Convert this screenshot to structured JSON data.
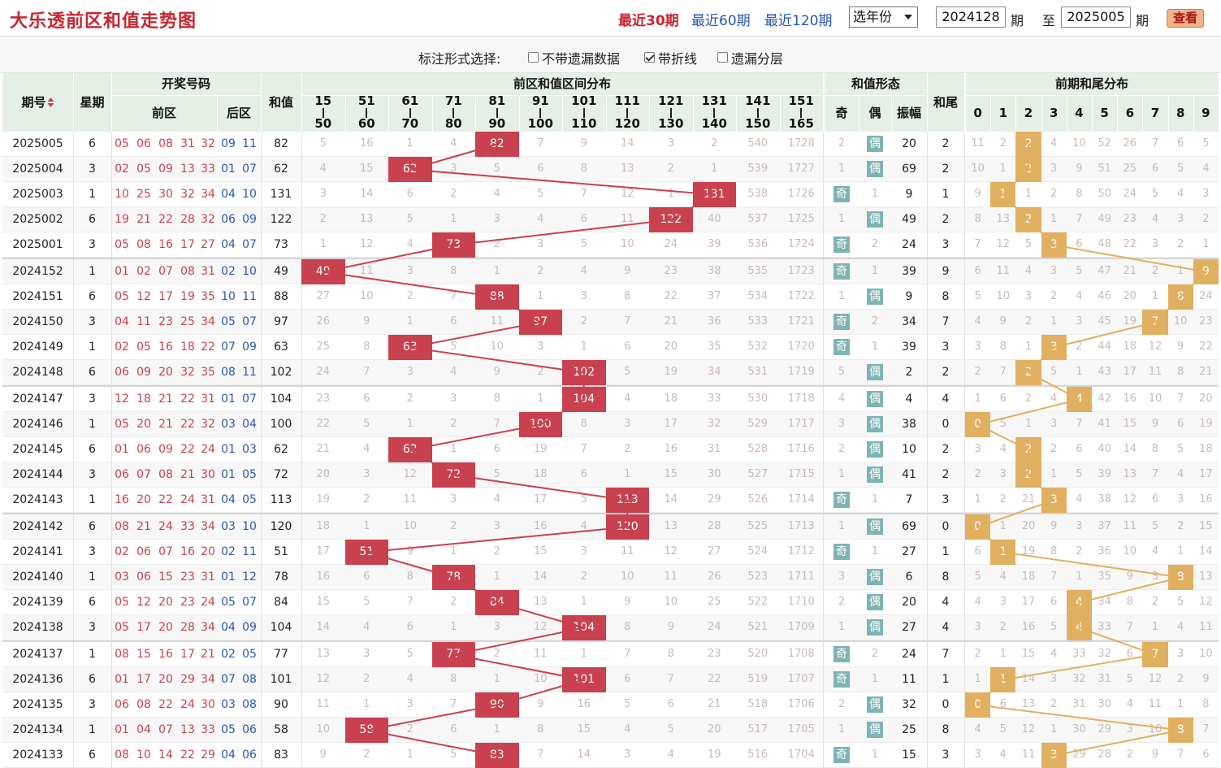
{
  "header": {
    "title": "大乐透前区和值走势图",
    "period_links": [
      "最近30期",
      "最近60期",
      "最近120期"
    ],
    "year_select": "选年份",
    "from_issue": "2024128",
    "to_issue": "2025005",
    "issue_unit": "期",
    "to_label": "至",
    "query_button": "查看"
  },
  "options": {
    "label": "标注形式选择:",
    "items": [
      {
        "label": "不带遗漏数据",
        "checked": false
      },
      {
        "label": "带折线",
        "checked": true
      },
      {
        "label": "遗漏分层",
        "checked": false
      }
    ]
  },
  "table_headers": {
    "issue": "期号",
    "weekday": "星期",
    "draw": "开奖号码",
    "front": "前区",
    "back": "后区",
    "sum": "和值",
    "distribution": "前区和值区间分布",
    "ranges": [
      [
        "15",
        "50"
      ],
      [
        "51",
        "60"
      ],
      [
        "61",
        "70"
      ],
      [
        "71",
        "80"
      ],
      [
        "81",
        "90"
      ],
      [
        "91",
        "100"
      ],
      [
        "101",
        "110"
      ],
      [
        "111",
        "120"
      ],
      [
        "121",
        "130"
      ],
      [
        "131",
        "140"
      ],
      [
        "141",
        "150"
      ],
      [
        "151",
        "165"
      ]
    ],
    "form": "和值形态",
    "odd": "奇",
    "even": "偶",
    "amp": "振幅",
    "tail": "和尾",
    "tail_dist": "前期和尾分布",
    "digits": [
      "0",
      "1",
      "2",
      "3",
      "4",
      "5",
      "6",
      "7",
      "8",
      "9"
    ]
  },
  "colors": {
    "red_ball": "#c9404f",
    "blue_ball": "#2a56b8",
    "hit": "#c9404f",
    "tail_hit": "#e0b060",
    "odd_even_box": "#7fb3b3"
  },
  "rows": [
    {
      "issue": "2025005",
      "wk": "6",
      "front": [
        "05",
        "06",
        "08",
        "31",
        "32"
      ],
      "back": [
        "09",
        "11"
      ],
      "sum": "82",
      "dist": [
        "5",
        "16",
        "1",
        "4",
        "82",
        "7",
        "9",
        "14",
        "3",
        "2",
        "540",
        "1728"
      ],
      "hit": 4,
      "oe": [
        "2",
        "偶"
      ],
      "oeHit": 1,
      "amp": "20",
      "tail": "2",
      "td": [
        "11",
        "2",
        "2",
        "4",
        "10",
        "52",
        "26",
        "7",
        "6",
        "5"
      ],
      "tHit": 2
    },
    {
      "issue": "2025004",
      "wk": "3",
      "front": [
        "02",
        "05",
        "09",
        "13",
        "33"
      ],
      "back": [
        "01",
        "07"
      ],
      "sum": "62",
      "dist": [
        "4",
        "15",
        "62",
        "3",
        "5",
        "6",
        "8",
        "13",
        "2",
        "1",
        "539",
        "1727"
      ],
      "hit": 2,
      "oe": [
        "1",
        "偶"
      ],
      "oeHit": 1,
      "amp": "69",
      "tail": "2",
      "td": [
        "10",
        "1",
        "2",
        "3",
        "9",
        "51",
        "25",
        "6",
        "5",
        "4"
      ],
      "tHit": 2
    },
    {
      "issue": "2025003",
      "wk": "1",
      "front": [
        "10",
        "25",
        "30",
        "32",
        "34"
      ],
      "back": [
        "04",
        "10"
      ],
      "sum": "131",
      "dist": [
        "3",
        "14",
        "6",
        "2",
        "4",
        "5",
        "7",
        "12",
        "1",
        "131",
        "538",
        "1726"
      ],
      "hit": 9,
      "oe": [
        "奇",
        "1"
      ],
      "oeHit": 0,
      "amp": "9",
      "tail": "1",
      "td": [
        "9",
        "1",
        "1",
        "2",
        "8",
        "50",
        "24",
        "5",
        "4",
        "3"
      ],
      "tHit": 1
    },
    {
      "issue": "2025002",
      "wk": "6",
      "front": [
        "19",
        "21",
        "22",
        "28",
        "32"
      ],
      "back": [
        "06",
        "09"
      ],
      "sum": "122",
      "dist": [
        "2",
        "13",
        "5",
        "1",
        "3",
        "4",
        "6",
        "11",
        "122",
        "40",
        "537",
        "1725"
      ],
      "hit": 8,
      "oe": [
        "1",
        "偶"
      ],
      "oeHit": 1,
      "amp": "49",
      "tail": "2",
      "td": [
        "8",
        "13",
        "2",
        "1",
        "7",
        "49",
        "23",
        "4",
        "3",
        "2"
      ],
      "tHit": 2
    },
    {
      "issue": "2025001",
      "wk": "3",
      "front": [
        "05",
        "08",
        "16",
        "17",
        "27"
      ],
      "back": [
        "04",
        "07"
      ],
      "sum": "73",
      "dist": [
        "1",
        "12",
        "4",
        "73",
        "2",
        "3",
        "5",
        "10",
        "24",
        "39",
        "536",
        "1724"
      ],
      "hit": 3,
      "oe": [
        "奇",
        "2"
      ],
      "oeHit": 0,
      "amp": "24",
      "tail": "3",
      "td": [
        "7",
        "12",
        "5",
        "3",
        "6",
        "48",
        "22",
        "3",
        "2",
        "1"
      ],
      "tHit": 3
    },
    {
      "issue": "2024152",
      "wk": "1",
      "front": [
        "01",
        "02",
        "07",
        "08",
        "31"
      ],
      "back": [
        "02",
        "10"
      ],
      "sum": "49",
      "dist": [
        "49",
        "11",
        "3",
        "8",
        "1",
        "2",
        "4",
        "9",
        "23",
        "38",
        "535",
        "1723"
      ],
      "hit": 0,
      "oe": [
        "奇",
        "1"
      ],
      "oeHit": 0,
      "amp": "39",
      "tail": "9",
      "td": [
        "6",
        "11",
        "4",
        "3",
        "5",
        "47",
        "21",
        "2",
        "1",
        "9"
      ],
      "tHit": 9
    },
    {
      "issue": "2024151",
      "wk": "6",
      "front": [
        "05",
        "12",
        "17",
        "19",
        "35"
      ],
      "back": [
        "10",
        "11"
      ],
      "sum": "88",
      "dist": [
        "27",
        "10",
        "2",
        "7",
        "88",
        "1",
        "3",
        "8",
        "22",
        "37",
        "534",
        "1722"
      ],
      "hit": 4,
      "oe": [
        "1",
        "偶"
      ],
      "oeHit": 1,
      "amp": "9",
      "tail": "8",
      "td": [
        "5",
        "10",
        "3",
        "2",
        "4",
        "46",
        "20",
        "1",
        "8",
        "24"
      ],
      "tHit": 8
    },
    {
      "issue": "2024150",
      "wk": "3",
      "front": [
        "04",
        "11",
        "23",
        "25",
        "34"
      ],
      "back": [
        "05",
        "07"
      ],
      "sum": "97",
      "dist": [
        "26",
        "9",
        "1",
        "6",
        "11",
        "97",
        "2",
        "7",
        "21",
        "36",
        "533",
        "1721"
      ],
      "hit": 5,
      "oe": [
        "奇",
        "2"
      ],
      "oeHit": 0,
      "amp": "34",
      "tail": "7",
      "td": [
        "4",
        "9",
        "2",
        "1",
        "3",
        "45",
        "19",
        "7",
        "10",
        "23"
      ],
      "tHit": 7
    },
    {
      "issue": "2024149",
      "wk": "1",
      "front": [
        "02",
        "05",
        "16",
        "18",
        "22"
      ],
      "back": [
        "07",
        "09"
      ],
      "sum": "63",
      "dist": [
        "25",
        "8",
        "63",
        "5",
        "10",
        "3",
        "1",
        "6",
        "20",
        "35",
        "532",
        "1720"
      ],
      "hit": 2,
      "oe": [
        "奇",
        "1"
      ],
      "oeHit": 0,
      "amp": "39",
      "tail": "3",
      "td": [
        "3",
        "8",
        "1",
        "3",
        "2",
        "44",
        "18",
        "12",
        "9",
        "22"
      ],
      "tHit": 3
    },
    {
      "issue": "2024148",
      "wk": "6",
      "front": [
        "06",
        "09",
        "20",
        "32",
        "35"
      ],
      "back": [
        "08",
        "11"
      ],
      "sum": "102",
      "dist": [
        "24",
        "7",
        "3",
        "4",
        "9",
        "2",
        "102",
        "5",
        "19",
        "34",
        "531",
        "1719"
      ],
      "hit": 6,
      "oe": [
        "5",
        "偶"
      ],
      "oeHit": 1,
      "amp": "2",
      "tail": "2",
      "td": [
        "2",
        "7",
        "2",
        "5",
        "1",
        "43",
        "17",
        "11",
        "8",
        "21"
      ],
      "tHit": 2
    },
    {
      "issue": "2024147",
      "wk": "3",
      "front": [
        "12",
        "18",
        "21",
        "22",
        "31"
      ],
      "back": [
        "01",
        "07"
      ],
      "sum": "104",
      "dist": [
        "23",
        "6",
        "2",
        "3",
        "8",
        "1",
        "104",
        "4",
        "18",
        "33",
        "530",
        "1718"
      ],
      "hit": 6,
      "oe": [
        "4",
        "偶"
      ],
      "oeHit": 1,
      "amp": "4",
      "tail": "4",
      "td": [
        "1",
        "6",
        "2",
        "4",
        "4",
        "42",
        "16",
        "10",
        "7",
        "20"
      ],
      "tHit": 4
    },
    {
      "issue": "2024146",
      "wk": "1",
      "front": [
        "05",
        "20",
        "21",
        "22",
        "32"
      ],
      "back": [
        "03",
        "04"
      ],
      "sum": "100",
      "dist": [
        "22",
        "5",
        "1",
        "2",
        "7",
        "100",
        "8",
        "3",
        "17",
        "32",
        "529",
        "1717"
      ],
      "hit": 5,
      "oe": [
        "3",
        "偶"
      ],
      "oeHit": 1,
      "amp": "38",
      "tail": "0",
      "td": [
        "0",
        "5",
        "1",
        "3",
        "7",
        "41",
        "15",
        "9",
        "6",
        "19"
      ],
      "tHit": 0
    },
    {
      "issue": "2024145",
      "wk": "6",
      "front": [
        "01",
        "06",
        "09",
        "22",
        "24"
      ],
      "back": [
        "01",
        "03"
      ],
      "sum": "62",
      "dist": [
        "21",
        "4",
        "62",
        "1",
        "6",
        "19",
        "7",
        "2",
        "16",
        "31",
        "528",
        "1716"
      ],
      "hit": 2,
      "oe": [
        "2",
        "偶"
      ],
      "oeHit": 1,
      "amp": "10",
      "tail": "2",
      "td": [
        "3",
        "4",
        "2",
        "2",
        "6",
        "40",
        "14",
        "8",
        "5",
        "18"
      ],
      "tHit": 2
    },
    {
      "issue": "2024144",
      "wk": "3",
      "front": [
        "06",
        "07",
        "08",
        "21",
        "30"
      ],
      "back": [
        "01",
        "05"
      ],
      "sum": "72",
      "dist": [
        "20",
        "3",
        "12",
        "72",
        "5",
        "18",
        "6",
        "1",
        "15",
        "30",
        "527",
        "1715"
      ],
      "hit": 3,
      "oe": [
        "1",
        "偶"
      ],
      "oeHit": 1,
      "amp": "41",
      "tail": "2",
      "td": [
        "2",
        "3",
        "2",
        "1",
        "5",
        "39",
        "13",
        "7",
        "4",
        "17"
      ],
      "tHit": 2
    },
    {
      "issue": "2024143",
      "wk": "1",
      "front": [
        "16",
        "20",
        "22",
        "24",
        "31"
      ],
      "back": [
        "04",
        "05"
      ],
      "sum": "113",
      "dist": [
        "19",
        "2",
        "11",
        "3",
        "4",
        "17",
        "5",
        "113",
        "14",
        "29",
        "526",
        "1714"
      ],
      "hit": 7,
      "oe": [
        "奇",
        "1"
      ],
      "oeHit": 0,
      "amp": "7",
      "tail": "3",
      "td": [
        "1",
        "2",
        "21",
        "3",
        "4",
        "38",
        "12",
        "6",
        "3",
        "16"
      ],
      "tHit": 3
    },
    {
      "issue": "2024142",
      "wk": "6",
      "front": [
        "08",
        "21",
        "24",
        "33",
        "34"
      ],
      "back": [
        "03",
        "10"
      ],
      "sum": "120",
      "dist": [
        "18",
        "1",
        "10",
        "2",
        "3",
        "16",
        "4",
        "120",
        "13",
        "28",
        "525",
        "1713"
      ],
      "hit": 7,
      "oe": [
        "1",
        "偶"
      ],
      "oeHit": 1,
      "amp": "69",
      "tail": "0",
      "td": [
        "0",
        "1",
        "20",
        "9",
        "3",
        "37",
        "11",
        "5",
        "2",
        "15"
      ],
      "tHit": 0
    },
    {
      "issue": "2024141",
      "wk": "3",
      "front": [
        "02",
        "06",
        "07",
        "16",
        "20"
      ],
      "back": [
        "02",
        "11"
      ],
      "sum": "51",
      "dist": [
        "17",
        "51",
        "9",
        "1",
        "2",
        "15",
        "3",
        "11",
        "12",
        "27",
        "524",
        "1712"
      ],
      "hit": 1,
      "oe": [
        "奇",
        "1"
      ],
      "oeHit": 0,
      "amp": "27",
      "tail": "1",
      "td": [
        "6",
        "1",
        "19",
        "8",
        "2",
        "36",
        "10",
        "4",
        "1",
        "14"
      ],
      "tHit": 1
    },
    {
      "issue": "2024140",
      "wk": "1",
      "front": [
        "03",
        "06",
        "15",
        "23",
        "31"
      ],
      "back": [
        "01",
        "12"
      ],
      "sum": "78",
      "dist": [
        "16",
        "6",
        "8",
        "78",
        "1",
        "14",
        "2",
        "10",
        "11",
        "26",
        "523",
        "1711"
      ],
      "hit": 3,
      "oe": [
        "3",
        "偶"
      ],
      "oeHit": 1,
      "amp": "6",
      "tail": "8",
      "td": [
        "5",
        "4",
        "18",
        "7",
        "1",
        "35",
        "9",
        "3",
        "8",
        "13"
      ],
      "tHit": 8
    },
    {
      "issue": "2024139",
      "wk": "6",
      "front": [
        "05",
        "12",
        "20",
        "23",
        "24"
      ],
      "back": [
        "05",
        "07"
      ],
      "sum": "84",
      "dist": [
        "15",
        "5",
        "7",
        "2",
        "84",
        "13",
        "1",
        "9",
        "10",
        "25",
        "522",
        "1710"
      ],
      "hit": 4,
      "oe": [
        "2",
        "偶"
      ],
      "oeHit": 1,
      "amp": "20",
      "tail": "4",
      "td": [
        "4",
        "3",
        "17",
        "6",
        "4",
        "34",
        "8",
        "2",
        "5",
        "12"
      ],
      "tHit": 4
    },
    {
      "issue": "2024138",
      "wk": "3",
      "front": [
        "05",
        "17",
        "20",
        "28",
        "34"
      ],
      "back": [
        "04",
        "09"
      ],
      "sum": "104",
      "dist": [
        "14",
        "4",
        "6",
        "1",
        "3",
        "12",
        "104",
        "8",
        "9",
        "24",
        "521",
        "1709"
      ],
      "hit": 6,
      "oe": [
        "1",
        "偶"
      ],
      "oeHit": 1,
      "amp": "27",
      "tail": "4",
      "td": [
        "3",
        "2",
        "16",
        "5",
        "4",
        "33",
        "7",
        "1",
        "4",
        "11"
      ],
      "tHit": 4
    },
    {
      "issue": "2024137",
      "wk": "1",
      "front": [
        "08",
        "15",
        "16",
        "17",
        "21"
      ],
      "back": [
        "02",
        "05"
      ],
      "sum": "77",
      "dist": [
        "13",
        "3",
        "5",
        "77",
        "2",
        "11",
        "1",
        "7",
        "8",
        "23",
        "520",
        "1708"
      ],
      "hit": 3,
      "oe": [
        "奇",
        "2"
      ],
      "oeHit": 0,
      "amp": "24",
      "tail": "7",
      "td": [
        "2",
        "1",
        "15",
        "4",
        "33",
        "32",
        "6",
        "7",
        "3",
        "10"
      ],
      "tHit": 7
    },
    {
      "issue": "2024136",
      "wk": "6",
      "front": [
        "01",
        "17",
        "20",
        "29",
        "34"
      ],
      "back": [
        "07",
        "08"
      ],
      "sum": "101",
      "dist": [
        "12",
        "2",
        "4",
        "8",
        "1",
        "10",
        "101",
        "6",
        "7",
        "22",
        "519",
        "1707"
      ],
      "hit": 6,
      "oe": [
        "奇",
        "1"
      ],
      "oeHit": 0,
      "amp": "11",
      "tail": "1",
      "td": [
        "1",
        "1",
        "14",
        "3",
        "32",
        "31",
        "5",
        "12",
        "2",
        "9"
      ],
      "tHit": 1
    },
    {
      "issue": "2024135",
      "wk": "3",
      "front": [
        "06",
        "08",
        "22",
        "24",
        "30"
      ],
      "back": [
        "03",
        "08"
      ],
      "sum": "90",
      "dist": [
        "11",
        "1",
        "3",
        "7",
        "90",
        "9",
        "16",
        "5",
        "6",
        "21",
        "518",
        "1706"
      ],
      "hit": 4,
      "oe": [
        "2",
        "偶"
      ],
      "oeHit": 1,
      "amp": "32",
      "tail": "0",
      "td": [
        "0",
        "6",
        "13",
        "2",
        "31",
        "30",
        "4",
        "11",
        "1",
        "8"
      ],
      "tHit": 0
    },
    {
      "issue": "2024134",
      "wk": "1",
      "front": [
        "01",
        "04",
        "07",
        "13",
        "33"
      ],
      "back": [
        "05",
        "06"
      ],
      "sum": "58",
      "dist": [
        "10",
        "58",
        "2",
        "6",
        "1",
        "8",
        "15",
        "4",
        "5",
        "20",
        "517",
        "1705"
      ],
      "hit": 1,
      "oe": [
        "1",
        "偶"
      ],
      "oeHit": 1,
      "amp": "25",
      "tail": "8",
      "td": [
        "4",
        "5",
        "12",
        "1",
        "30",
        "29",
        "3",
        "10",
        "8",
        "7"
      ],
      "tHit": 8
    },
    {
      "issue": "2024133",
      "wk": "6",
      "front": [
        "08",
        "10",
        "14",
        "22",
        "29"
      ],
      "back": [
        "04",
        "06"
      ],
      "sum": "83",
      "dist": [
        "9",
        "2",
        "1",
        "5",
        "83",
        "7",
        "14",
        "3",
        "4",
        "19",
        "516",
        "1704"
      ],
      "hit": 4,
      "oe": [
        "奇",
        "1"
      ],
      "oeHit": 0,
      "amp": "15",
      "tail": "3",
      "td": [
        "3",
        "4",
        "11",
        "3",
        "29",
        "28",
        "2",
        "9",
        "7",
        "6"
      ],
      "tHit": 3
    }
  ]
}
